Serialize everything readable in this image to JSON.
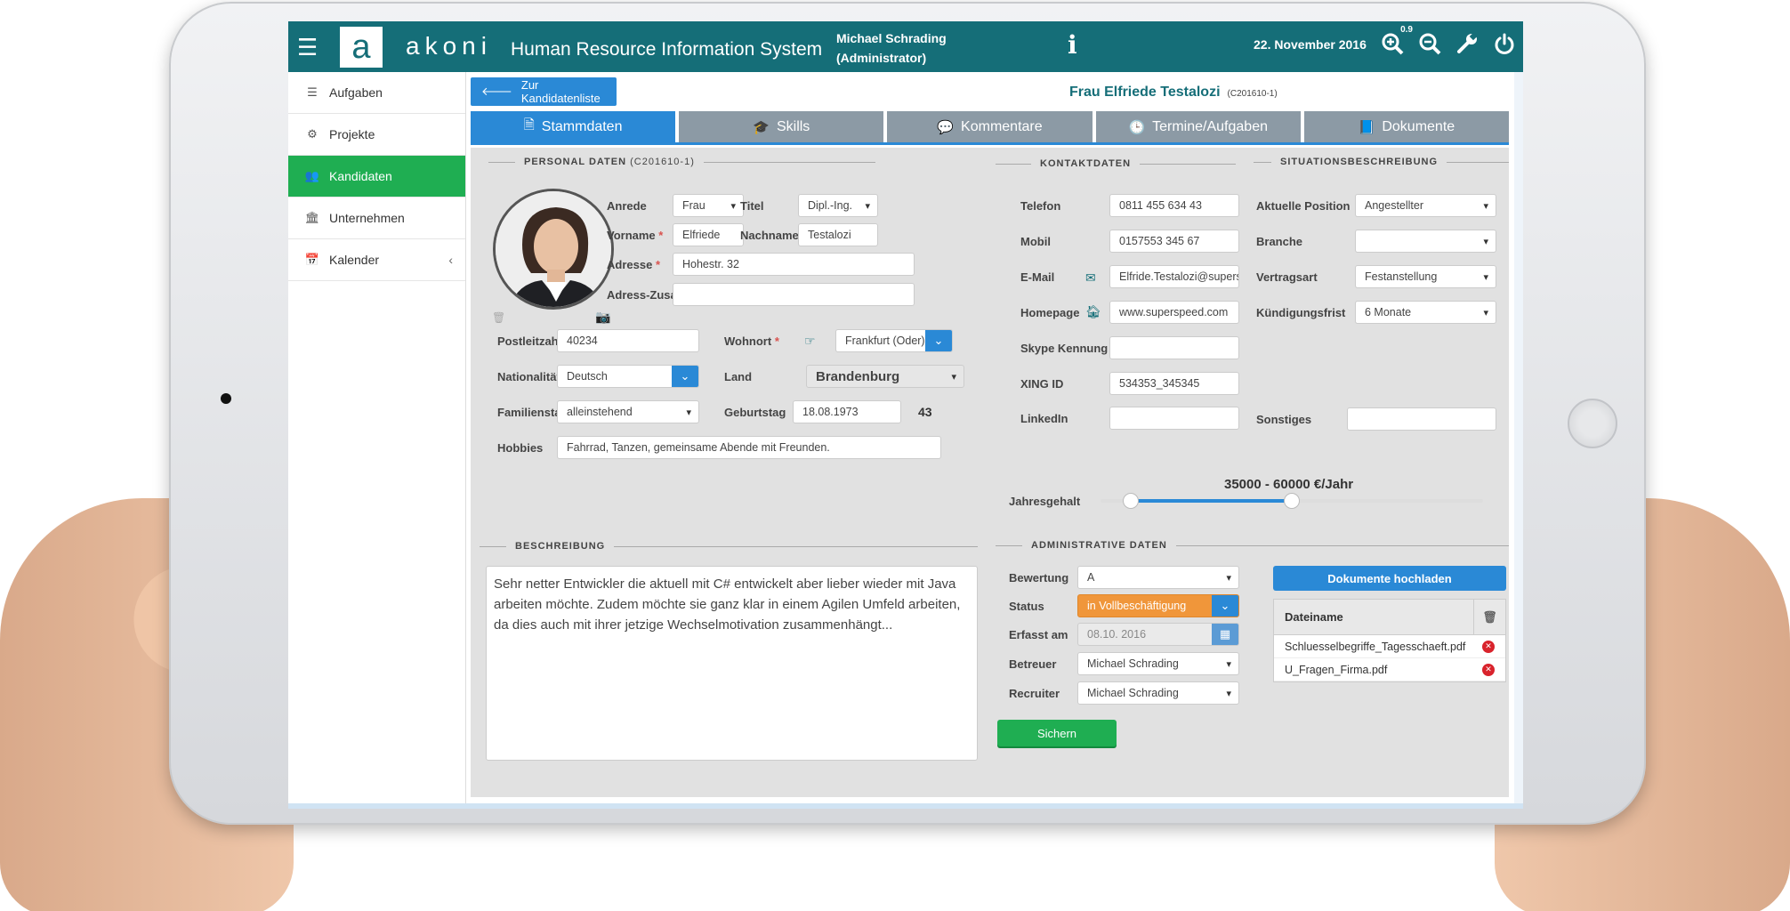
{
  "app": {
    "brand": "akoni",
    "logo_letter": "a",
    "title": "Human Resource Information System",
    "user_line1": "Michael Schrading",
    "user_line2": "(Administrator)",
    "info_symbol": "i",
    "date": "22. November 2016",
    "zoom_level": "0.9",
    "accent_color": "#156e78",
    "active_color": "#1fae52",
    "primary_color": "#2a89d6"
  },
  "sidebar": {
    "items": [
      {
        "label": "Aufgaben",
        "icon": "tasks-icon"
      },
      {
        "label": "Projekte",
        "icon": "gears-icon"
      },
      {
        "label": "Kandidaten",
        "icon": "users-icon"
      },
      {
        "label": "Unternehmen",
        "icon": "bank-icon"
      },
      {
        "label": "Kalender",
        "icon": "calendar-icon"
      }
    ],
    "active_index": 2
  },
  "header": {
    "back_label": "Zur Kandidatenliste",
    "candidate_name": "Frau Elfriede Testalozi",
    "candidate_id": "(C201610-1)"
  },
  "tabs": [
    {
      "label": "Stammdaten",
      "icon": "file-icon"
    },
    {
      "label": "Skills",
      "icon": "graduation-cap-icon"
    },
    {
      "label": "Kommentare",
      "icon": "comment-icon"
    },
    {
      "label": "Termine/Aufgaben",
      "icon": "clock-icon"
    },
    {
      "label": "Dokumente",
      "icon": "book-icon"
    }
  ],
  "personal": {
    "section_title": "PERSONAL DATEN",
    "section_id": "(C201610-1)",
    "anrede_label": "Anrede",
    "anrede": "Frau",
    "titel_label": "Titel",
    "titel": "Dipl.-Ing.",
    "vorname_label": "Vorname",
    "vorname": "Elfriede",
    "nachname_label": "Nachname",
    "nachname": "Testalozi",
    "adresse_label": "Adresse",
    "adresse": "Hohestr. 32",
    "adresszusatz_label": "Adress-Zusatz",
    "adresszusatz": "",
    "plz_label": "Postleitzahl",
    "plz": "40234",
    "wohnort_label": "Wohnort",
    "wohnort": "Frankfurt (Oder)",
    "nationalitaet_label": "Nationalität",
    "nationalitaet": "Deutsch",
    "land_label": "Land",
    "land": "Brandenburg",
    "familienstand_label": "Familienstand",
    "familienstand": "alleinstehend",
    "geburtstag_label": "Geburtstag",
    "geburtstag": "18.08.1973",
    "alter": "43",
    "hobbies_label": "Hobbies",
    "hobbies": "Fahrrad, Tanzen, gemeinsame Abende mit Freunden."
  },
  "kontakt": {
    "section_title": "KONTAKTDATEN",
    "telefon_label": "Telefon",
    "telefon": "0811 455 634 43",
    "mobil_label": "Mobil",
    "mobil": "0157553 345 67",
    "email_label": "E-Mail",
    "email": "Elfride.Testalozi@superspeed.com",
    "homepage_label": "Homepage",
    "homepage": "www.superspeed.com",
    "skype_label": "Skype Kennung",
    "skype": "",
    "xing_label": "XING ID",
    "xing": "534353_345345",
    "linkedin_label": "LinkedIn",
    "linkedin": ""
  },
  "situation": {
    "section_title": "SITUATIONSBESCHREIBUNG",
    "position_label": "Aktuelle Position",
    "position": "Angestellter",
    "branche_label": "Branche",
    "branche": "",
    "vertragsart_label": "Vertragsart",
    "vertragsart": "Festanstellung",
    "kuendigung_label": "Kündigungsfrist",
    "kuendigung": "6 Monate",
    "sonstiges_label": "Sonstiges",
    "sonstiges": ""
  },
  "gehalt": {
    "label": "Jahresgehalt",
    "range_text": "35000 - 60000 €/Jahr",
    "low_fraction": 0.08,
    "high_fraction": 0.5
  },
  "beschreibung": {
    "section_title": "BESCHREIBUNG",
    "text": "Sehr netter Entwickler die aktuell mit C# entwickelt aber lieber wieder mit Java arbeiten möchte. Zudem möchte sie ganz klar in einem Agilen Umfeld arbeiten, da dies auch mit ihrer jetzige Wechselmotivation zusammenhängt..."
  },
  "admin": {
    "section_title": "ADMINISTRATIVE DATEN",
    "bewertung_label": "Bewertung",
    "bewertung": "A",
    "status_label": "Status",
    "status": "in Vollbeschäftigung",
    "status_color": "#f0963a",
    "erfasst_label": "Erfasst am",
    "erfasst": "08.10. 2016",
    "betreuer_label": "Betreuer",
    "betreuer": "Michael Schrading",
    "recruiter_label": "Recruiter",
    "recruiter": "Michael Schrading",
    "save_label": "Sichern"
  },
  "documents": {
    "upload_label": "Dokumente hochladen",
    "column_header": "Dateiname",
    "files": [
      "Schluesselbegriffe_Tagesschaeft.pdf",
      "U_Fragen_Firma.pdf"
    ]
  }
}
